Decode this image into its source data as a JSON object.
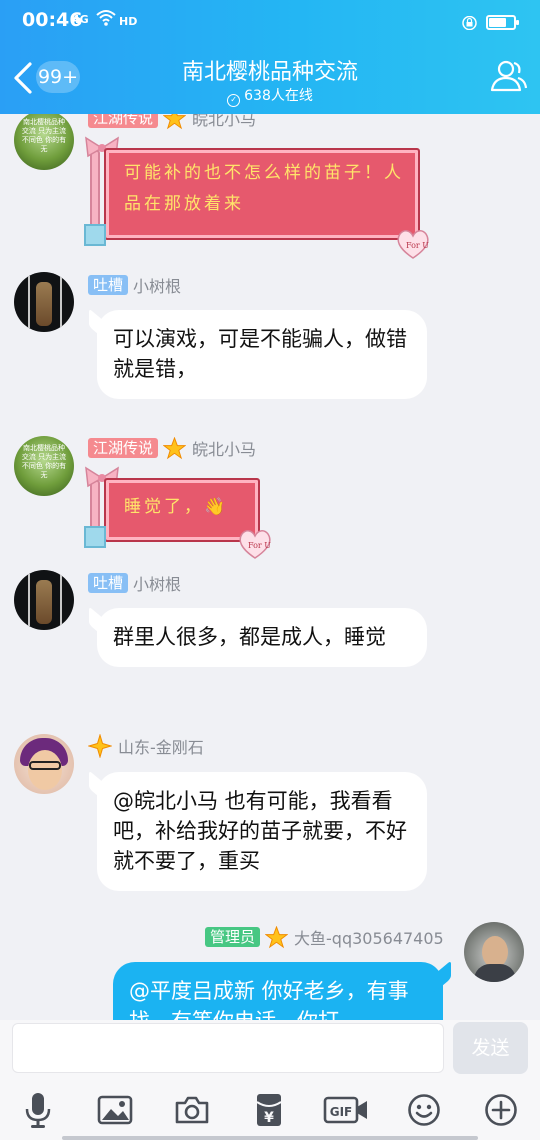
{
  "status_bar": {
    "time": "00:46",
    "network": "4G",
    "hd": "HD",
    "battery_level": 0.7
  },
  "header": {
    "back_count": "99+",
    "title": "南北樱桃品种交流",
    "online": "638人在线"
  },
  "messages": [
    {
      "type": "gift",
      "badge": "江湖传说",
      "sender": "皖北小马",
      "avatar_text": "南北樱桃品种交流 只为主流 不同色 你的有无",
      "text": "可能补的也不怎么样的苗子！人品在那放着来"
    },
    {
      "type": "text",
      "badge": "吐槽",
      "sender": "小树根",
      "text": "可以演戏，可是不能骗人，做错就是错，"
    },
    {
      "type": "gift",
      "badge": "江湖传说",
      "sender": "皖北小马",
      "avatar_text": "南北樱桃品种交流 只为主流 不同色 你的有无",
      "text": "睡觉了，👋"
    },
    {
      "type": "text",
      "badge": "吐槽",
      "sender": "小树根",
      "text": "群里人很多，都是成人，睡觉"
    },
    {
      "type": "text",
      "badge": "",
      "sender": "山东-金刚石",
      "text": "@皖北小马 也有可能，我看看吧，补给我好的苗子就要，不好就不要了，重买"
    },
    {
      "type": "text_out",
      "badge": "管理员",
      "sender": "大鱼-qq305647405",
      "text": "@平度吕成新 你好老乡，有事找，有等你电话，你打"
    }
  ],
  "input": {
    "placeholder": "",
    "send_label": "发送"
  },
  "toolbar": {
    "icons": [
      "microphone-icon",
      "image-icon",
      "camera-icon",
      "red-packet-icon",
      "gif-icon",
      "emoji-icon",
      "plus-icon"
    ],
    "gif_label": "GIF",
    "yen_label": "¥"
  },
  "colors": {
    "header": "#24b6f3",
    "outgoing_bubble": "#1bb3f2",
    "badge_red": "#f58a8f",
    "badge_blue": "#88bff5",
    "badge_green": "#47c783",
    "gift_box": "#e6596d",
    "gift_text": "#ffe46a"
  }
}
